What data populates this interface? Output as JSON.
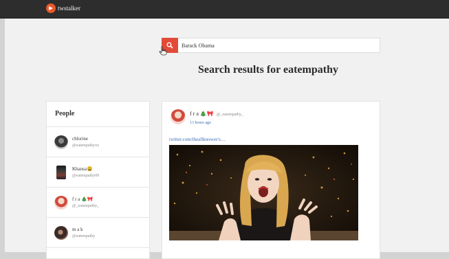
{
  "app": {
    "name": "twstalker"
  },
  "search": {
    "value": "Barack Obama"
  },
  "results": {
    "title": "Search results for eatempathy"
  },
  "people": {
    "heading": "People",
    "items": [
      {
        "name": "chlorine",
        "handle": "@eatempathyxx"
      },
      {
        "name": "Khansa😩",
        "handle": "@eatempathy09"
      },
      {
        "name": "f r a 🎄🎀",
        "handle": "@_eatempathy_"
      },
      {
        "name": "m a k",
        "handle": "@eatempathy"
      }
    ]
  },
  "tweet": {
    "author_name": "f r a 🎄🎀",
    "author_handle": "@_eatempathy_",
    "time": "13 hours ago",
    "link": "twitter.com/theallknower/s…"
  },
  "colors": {
    "accent": "#e24b3a",
    "link": "#3b6bb5",
    "topbar": "#2d2d2d"
  }
}
